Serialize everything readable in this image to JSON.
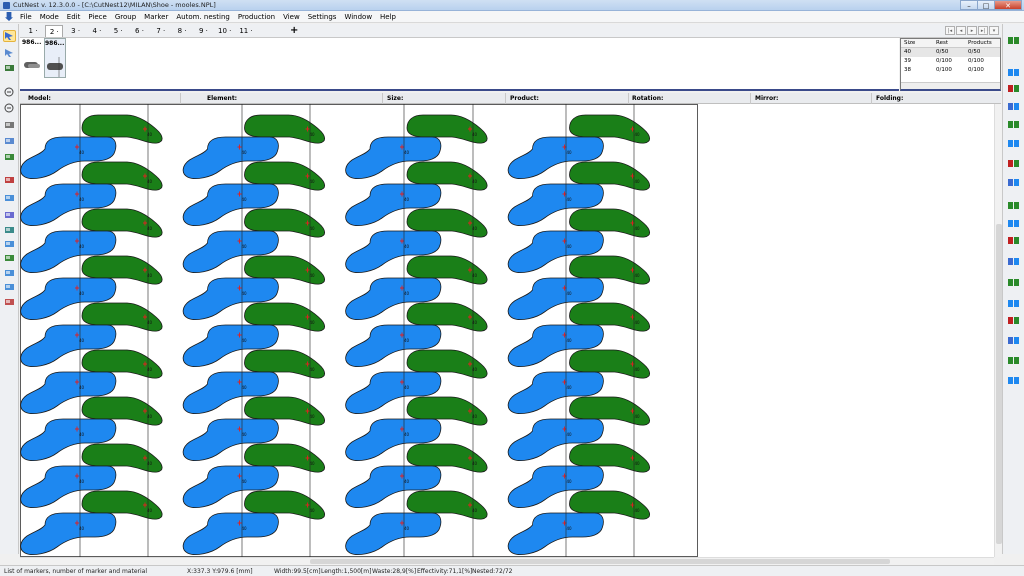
{
  "window": {
    "title": "CutNest v. 12.3.0.0 - [C:\\CutNest12\\MILAN\\Shoe - mooles.NPL]",
    "min": "–",
    "max": "□",
    "close": "✕"
  },
  "menu": [
    "File",
    "Mode",
    "Edit",
    "Piece",
    "Group",
    "Marker",
    "Autom. nesting",
    "Production",
    "View",
    "Settings",
    "Window",
    "Help"
  ],
  "marker_tabs": [
    "1",
    "2",
    "3",
    "4",
    "5",
    "6",
    "7",
    "8",
    "9",
    "10",
    "11"
  ],
  "active_marker_tab": "2",
  "add_marker": "+",
  "thumbnails": [
    {
      "label": "986..."
    },
    {
      "label": "986..."
    }
  ],
  "size_table": {
    "headers": [
      "Size",
      "Rest",
      "Products"
    ],
    "rows": [
      [
        "40",
        "0/50",
        "0/50"
      ],
      [
        "39",
        "0/100",
        "0/100"
      ],
      [
        "38",
        "0/100",
        "0/100"
      ]
    ]
  },
  "columns": [
    "Model:",
    "Element:",
    "Size:",
    "Product:",
    "Rotation:",
    "Mirror:",
    "Folding:"
  ],
  "pieces": {
    "size_label": "40",
    "colors": {
      "blue": "#1e88f0",
      "green": "#1a7f18",
      "outline": "#1a1a1a",
      "marker": "#e02020"
    },
    "rows": 9,
    "columns": 4
  },
  "status": {
    "hint": "List of markers, number of marker and material",
    "coords": "X:337.3  Y:979.6 [mm]",
    "width": "Width:99.5[cm]",
    "length": "Length:1,500[m]",
    "waste": "Waste:28,9[%]",
    "effectivity": "Effectivity:71,1[%]",
    "nested": "Nested:72/72"
  }
}
